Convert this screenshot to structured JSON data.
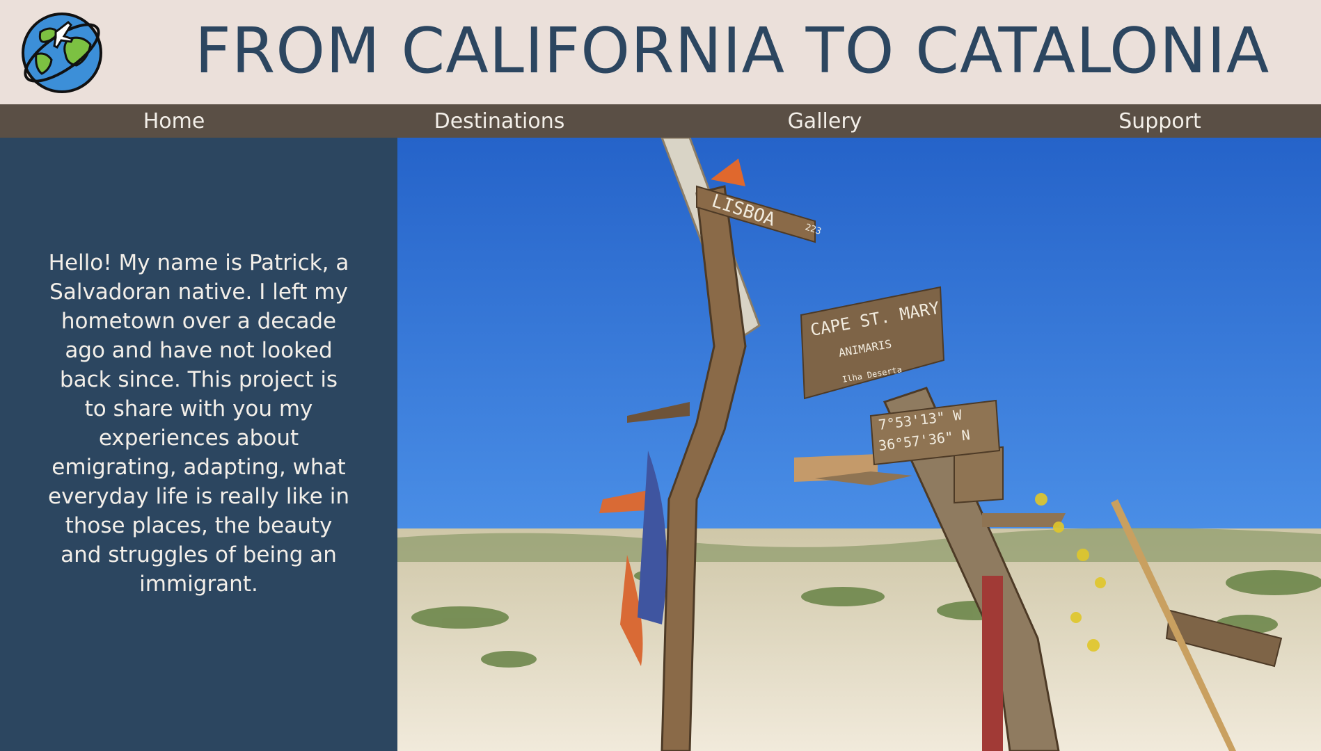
{
  "header": {
    "title": "FROM CALIFORNIA TO CATALONIA",
    "logo_icon": "globe-airplane-icon"
  },
  "nav": {
    "items": [
      {
        "label": "Home"
      },
      {
        "label": "Destinations"
      },
      {
        "label": "Gallery"
      },
      {
        "label": "Support"
      }
    ]
  },
  "sidebar": {
    "intro": "Hello! My name is Patrick, a Salvadoran native. I left my hometown over a decade ago and have not looked back since. This project is to share with you my experiences about emigrating, adapting, what everyday life is really like in those places, the beauty and struggles of being an immigrant."
  },
  "photo": {
    "signs": {
      "lisboa": "LISBOA",
      "lisboa_km": "223",
      "cape": "CAPE ST. MARY",
      "animaris": "ANIMARIS",
      "ilha": "Ilha Deserta",
      "coord_w": "7°53'13\" W",
      "coord_n": "36°57'36\" N"
    }
  },
  "colors": {
    "header_bg": "#ebe0da",
    "title": "#2c4660",
    "nav_bg": "#5a4f45",
    "sidebar_bg": "#2c4660",
    "sky": "#2f6fd0"
  }
}
